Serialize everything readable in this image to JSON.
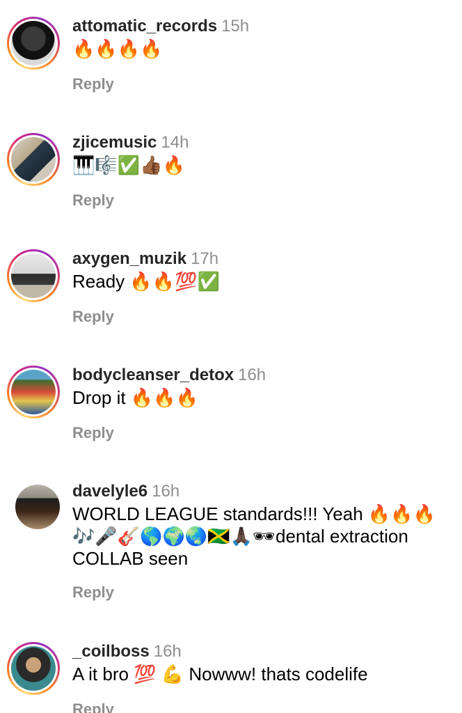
{
  "comments": [
    {
      "username": "attomatic_records",
      "time": "15h",
      "text": "🔥🔥🔥🔥",
      "reply": "Reply",
      "ring": true
    },
    {
      "username": "zjicemusic",
      "time": "14h",
      "text": "🎹🎼✅👍🏾🔥",
      "reply": "Reply",
      "ring": true
    },
    {
      "username": "axygen_muzik",
      "time": "17h",
      "text": "Ready 🔥🔥💯✅",
      "reply": "Reply",
      "ring": true
    },
    {
      "username": "bodycleanser_detox",
      "time": "16h",
      "text": "Drop it 🔥🔥🔥",
      "reply": "Reply",
      "ring": true
    },
    {
      "username": "davelyle6",
      "time": "16h",
      "text": "WORLD LEAGUE standards!!! Yeah 🔥🔥🔥🎶🎤🎸🌎🌍🌏🇯🇲🙏🏿🕶dental extraction COLLAB seen",
      "reply": "Reply",
      "ring": false
    },
    {
      "username": "_coilboss",
      "time": "16h",
      "text": "A it bro 💯 💪 Nowww! thats codelife",
      "reply": "Reply",
      "ring": true
    }
  ]
}
